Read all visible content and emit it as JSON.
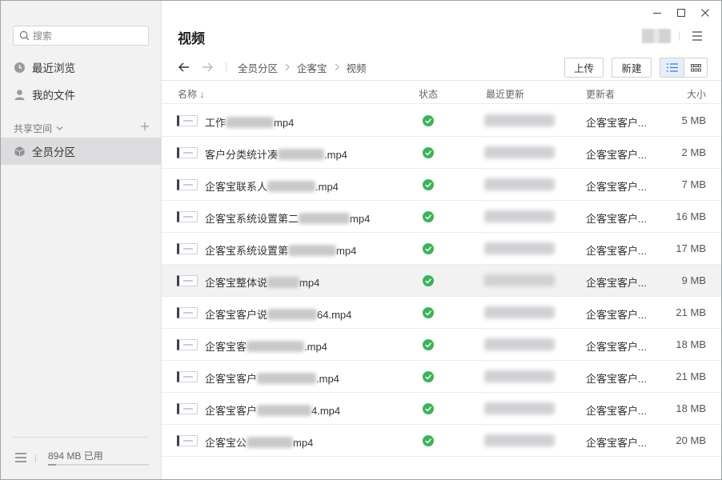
{
  "sidebar": {
    "search_placeholder": "搜索",
    "recent": "最近浏览",
    "my_files": "我的文件",
    "shared_space": "共享空间",
    "all_members": "全员分区",
    "usage": "894 MB 已用",
    "usage_fraction": 0.08
  },
  "header": {
    "title": "视频"
  },
  "breadcrumb": [
    "全员分区",
    "企客宝",
    "视频"
  ],
  "toolbar": {
    "upload": "上传",
    "new": "新建"
  },
  "columns": {
    "name": "名称",
    "sort_arrow": "↓",
    "status": "状态",
    "updated": "最近更新",
    "updater": "更新者",
    "size": "大小"
  },
  "files": [
    {
      "prefix": "工作",
      "suffix": "mp4",
      "updater": "企客宝客户...",
      "size": "5 MB"
    },
    {
      "prefix": "客户分类统计凑",
      "suffix": ".mp4",
      "updater": "企客宝客户...",
      "size": "2 MB"
    },
    {
      "prefix": "企客宝联系人",
      "suffix": ".mp4",
      "updater": "企客宝客户...",
      "size": "7 MB"
    },
    {
      "prefix": "企客宝系统设置第二",
      "suffix": "mp4",
      "updater": "企客宝客户...",
      "size": "16 MB"
    },
    {
      "prefix": "企客宝系统设置第",
      "suffix": "mp4",
      "updater": "企客宝客户...",
      "size": "17 MB"
    },
    {
      "prefix": "企客宝整体说",
      "suffix": "mp4",
      "updater": "企客宝客户...",
      "size": "9 MB"
    },
    {
      "prefix": "企客宝客户说",
      "suffix": "64.mp4",
      "updater": "企客宝客户...",
      "size": "21 MB"
    },
    {
      "prefix": "企客宝客",
      "suffix": ".mp4",
      "updater": "企客宝客户...",
      "size": "18 MB"
    },
    {
      "prefix": "企客宝客户",
      "suffix": ".mp4",
      "updater": "企客宝客户...",
      "size": "21 MB"
    },
    {
      "prefix": "企客宝客户",
      "suffix": "4.mp4",
      "updater": "企客宝客户...",
      "size": "18 MB"
    },
    {
      "prefix": "企客宝公",
      "suffix": "mp4",
      "updater": "企客宝客户...",
      "size": "20 MB"
    }
  ],
  "colors": {
    "status_ok": "#3cb35a",
    "sidebar_bg": "#f2f2f3",
    "active_nav": "#dcdcde"
  }
}
